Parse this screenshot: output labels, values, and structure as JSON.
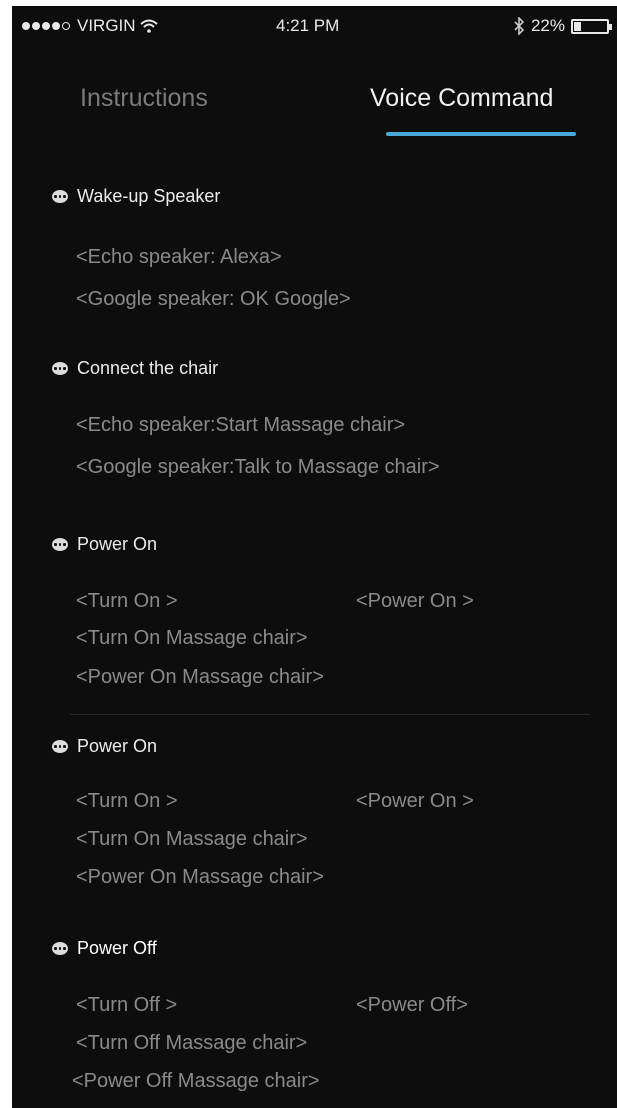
{
  "status_bar": {
    "carrier": "VIRGIN",
    "time": "4:21 PM",
    "battery": "22%",
    "battery_level": 0.22
  },
  "tabs": [
    {
      "label": "Instructions",
      "active": false
    },
    {
      "label": "Voice Command",
      "active": true
    }
  ],
  "colors": {
    "accent": "#4aa6d8",
    "background": "#0d0d0d"
  },
  "sections": [
    {
      "title": "Wake-up Speaker",
      "commands": [
        "<Echo speaker: Alexa>",
        "<Google speaker: OK Google>"
      ]
    },
    {
      "title": "Connect the chair",
      "commands": [
        "<Echo speaker:Start Massage chair>",
        "<Google speaker:Talk to Massage chair>"
      ]
    },
    {
      "title": "Power On",
      "commands": [
        "<Turn On >",
        "<Power On >",
        "<Turn On Massage chair>",
        "<Power On Massage chair>"
      ]
    },
    {
      "title": "Power On",
      "commands": [
        "<Turn On >",
        "<Power On >",
        "<Turn On Massage chair>",
        "<Power On Massage chair>"
      ]
    },
    {
      "title": "Power Off",
      "commands": [
        "<Turn Off >",
        "<Power Off>",
        "<Turn Off Massage chair>",
        "<Power Off Massage chair>"
      ]
    }
  ]
}
